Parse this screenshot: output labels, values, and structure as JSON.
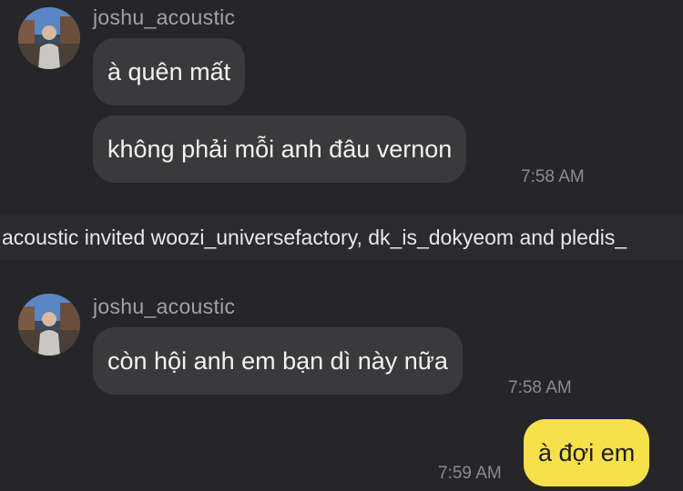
{
  "messages": {
    "group1": {
      "sender": "joshu_acoustic",
      "bubble1": "à quên mất",
      "bubble2": "không phải mỗi anh đâu vernon",
      "time": "7:58 AM"
    },
    "system": "acoustic invited woozi_universefactory, dk_is_dokyeom and pledis_",
    "group2": {
      "sender": "joshu_acoustic",
      "bubble1": "còn hội anh em bạn dì này nữa",
      "time": "7:58 AM"
    },
    "mine": {
      "bubble": "à đợi em",
      "time": "7:59 AM"
    }
  },
  "colors": {
    "background": "#262628",
    "incoming_bubble": "#3a3a3c",
    "outgoing_bubble": "#f7e14b",
    "timestamp": "#8c8c90"
  }
}
